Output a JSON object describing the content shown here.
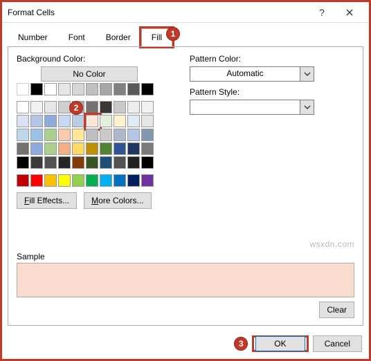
{
  "window": {
    "title": "Format Cells"
  },
  "tabs": {
    "t0": "Number",
    "t1": "Font",
    "t2": "Border",
    "t3": "Fill"
  },
  "left": {
    "bg_label": "Background Color:",
    "nocolor": "No Color",
    "fill_effects": "Fill Effects...",
    "more_colors": "More Colors..."
  },
  "right": {
    "pattern_color_label": "Pattern Color:",
    "pattern_color_value": "Automatic",
    "pattern_style_label": "Pattern Style:",
    "pattern_style_value": ""
  },
  "sample_label": "Sample",
  "clear": "Clear",
  "ok": "OK",
  "cancel": "Cancel",
  "callouts": {
    "c1": "1",
    "c2": "2",
    "c3": "3"
  },
  "watermark": "wsxdn.com",
  "swatches_row1": [
    "transparent",
    "#000000",
    "#ffffff",
    "#e7e6e6",
    "#d6d6d6",
    "#bfbfbf",
    "#a6a6a6",
    "#808080",
    "#595959",
    "#000000"
  ],
  "theme_grid": [
    [
      "#ffffff",
      "#f2f2f2",
      "#e7e6e6",
      "#d0cece",
      "#aeaaaa",
      "#767171",
      "#3b3838",
      "#c9c9c9",
      "#ededed",
      "#f2f2f2"
    ],
    [
      "#d9e1f2",
      "#b4c6e7",
      "#8ea9db",
      "#c6d9f0",
      "#b8cce4",
      "#fce4d6",
      "#e2efda",
      "#fff2cc",
      "#ddebf7",
      "#e7e6e6"
    ],
    [
      "#bdd7ee",
      "#9bc2e6",
      "#a9d08e",
      "#f8cbad",
      "#ffe699",
      "#bfbfbf",
      "#c9c9c9",
      "#adb9ca",
      "#b4c6e7",
      "#8497b0"
    ],
    [
      "#757171",
      "#8ea9db",
      "#a9d08e",
      "#f4b084",
      "#ffd966",
      "#bf8f00",
      "#548235",
      "#305496",
      "#203764",
      "#7b7b7b"
    ],
    [
      "#000000",
      "#3a3a3a",
      "#525252",
      "#262626",
      "#833c0c",
      "#375623",
      "#1f4e78",
      "#525252",
      "#222222",
      "#000000"
    ]
  ],
  "standard_row": [
    "#c00000",
    "#ff0000",
    "#ffc000",
    "#ffff00",
    "#92d050",
    "#00b050",
    "#00b0f0",
    "#0070c0",
    "#002060",
    "#7030a0"
  ],
  "sample_color": "#f9dcce",
  "selected_swatch": {
    "row": 1,
    "col": 5
  }
}
